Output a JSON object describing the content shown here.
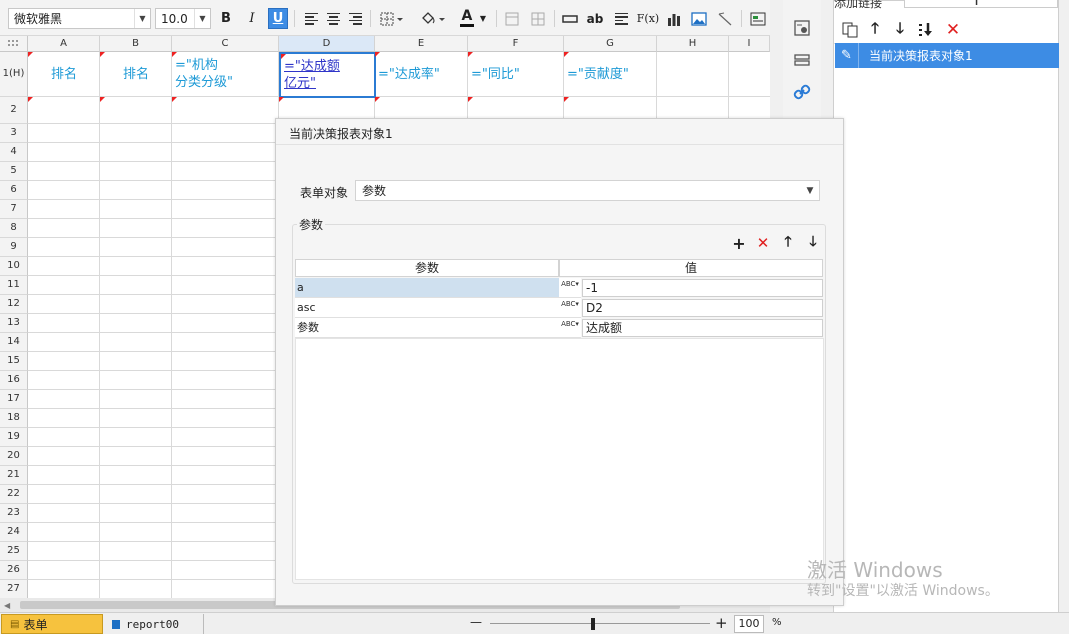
{
  "toolbar": {
    "font_family": "微软雅黑",
    "font_size": "10.0",
    "bold_label": "B",
    "italic_label": "I",
    "underline_label": "U",
    "text_a_label": "A",
    "ab_label": "ab",
    "fx_label": "F(x)"
  },
  "grid": {
    "columns": [
      "A",
      "B",
      "C",
      "D",
      "E",
      "F",
      "G",
      "H",
      "I"
    ],
    "rows": [
      "1(H)",
      "2",
      "3",
      "4",
      "5",
      "6",
      "7",
      "8",
      "9",
      "10",
      "11",
      "12",
      "13",
      "14",
      "15",
      "16",
      "17",
      "18",
      "19",
      "20",
      "21",
      "22",
      "23",
      "24",
      "25",
      "26",
      "27"
    ],
    "header_cells": {
      "a": "排名",
      "b": "排名",
      "c": "=\"机构\n分类分级\"",
      "d": "=\"达成额\n亿元\"",
      "e": "=\"达成率\"",
      "f": "=\"同比\"",
      "g": "=\"贡献度\""
    }
  },
  "sheet_tabs": {
    "form": "表单",
    "report": "report00"
  },
  "zoom": {
    "minus": "—",
    "plus": "+",
    "value": "100",
    "unit": "%"
  },
  "right_panel": {
    "add_link_label": "添加链接",
    "item_label": "当前决策报表对象1"
  },
  "dialog": {
    "title": "当前决策报表对象1",
    "form_object_label": "表单对象",
    "form_object_value": "参数",
    "params_group_label": "参数",
    "table_headers": {
      "param": "参数",
      "value": "值"
    },
    "rows": [
      {
        "name": "a",
        "type": "ABC",
        "value": "-1"
      },
      {
        "name": "asc",
        "type": "ABC",
        "value": "D2"
      },
      {
        "name": "参数",
        "type": "ABC",
        "value": "达成额"
      }
    ]
  },
  "watermark": {
    "line1": "激活 Windows",
    "line2": "转到\"设置\"以激活 Windows。"
  },
  "colors": {
    "accent": "#3d8ce4",
    "formula_text": "#1e9ad6",
    "selected_cell_text": "#2f35c8",
    "sheet_tab_active": "#f6c23e",
    "delete_red": "#e02020"
  }
}
